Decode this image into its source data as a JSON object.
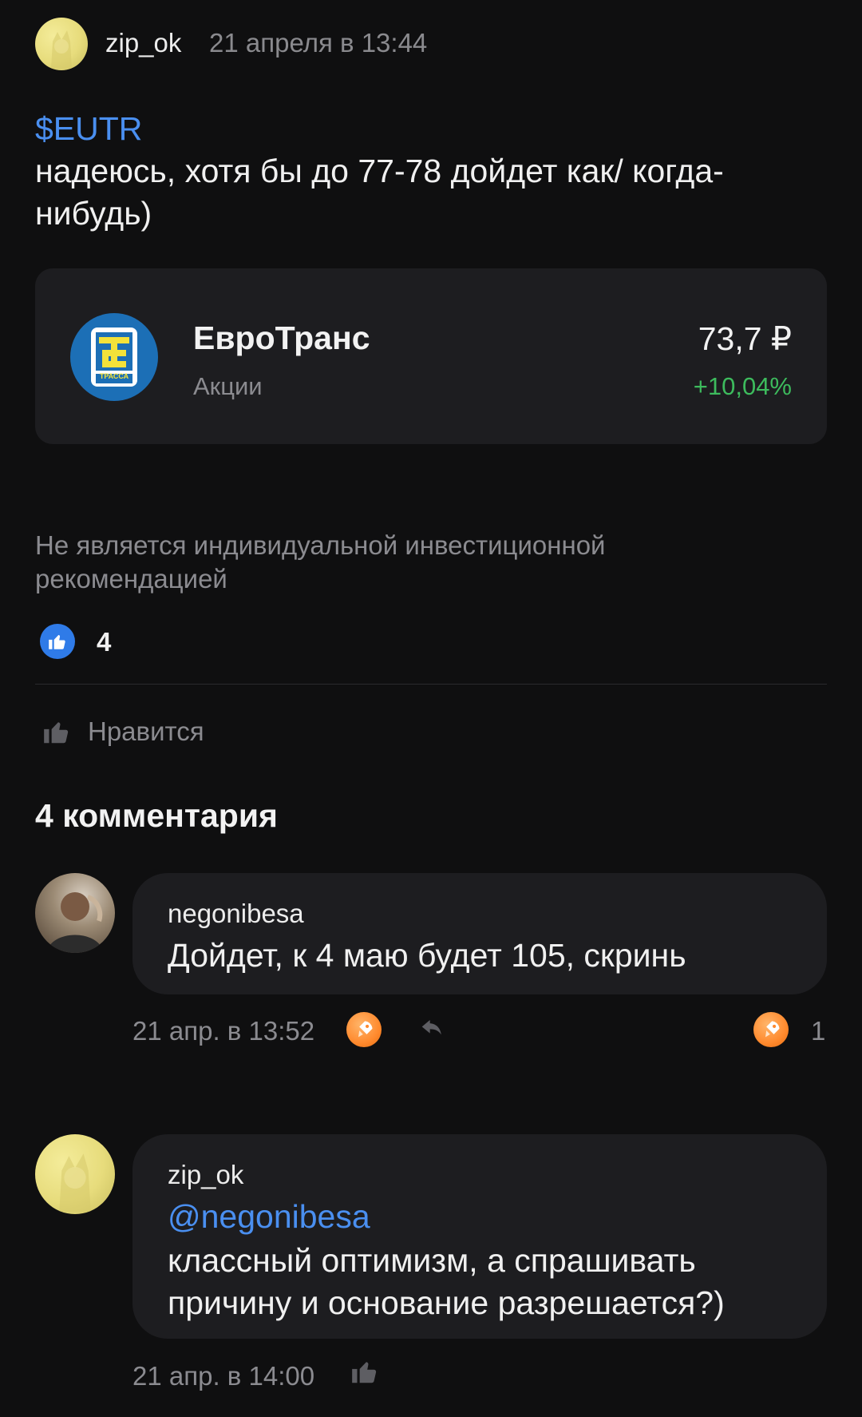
{
  "post": {
    "author": "zip_ok",
    "timestamp": "21 апреля в 13:44",
    "ticker": "$EUTR",
    "text": "надеюсь, хотя бы до 77-78 дойдет как/ когда-нибудь)"
  },
  "instrument": {
    "name": "ЕвроТранс",
    "type": "Акции",
    "price": "73,7 ₽",
    "change": "+10,04%",
    "logo_text": "ТРАССА"
  },
  "disclaimer": "Не является индивидуальной инвестиционной рекомендацией",
  "reactions": {
    "like_count": "4",
    "like_label": "Нравится"
  },
  "comments_title": "4 комментария",
  "comments": [
    {
      "author": "negonibesa",
      "text": "Дойдет, к 4 маю будет 105, скринь",
      "time": "21 апр. в 13:52",
      "rocket_count": "1"
    },
    {
      "author": "zip_ok",
      "mention": "@negonibesa",
      "text": "классный оптимизм, а спрашивать причину и основание разрешается?)",
      "time": "21 апр. в 14:00"
    }
  ],
  "colors": {
    "background": "#0f0f10",
    "card": "#1d1d20",
    "accent_link": "#4a8ff0",
    "positive": "#3dbb5d",
    "like_badge": "#2f7be8",
    "rocket": "#ff8a2e"
  },
  "icons": [
    "avatar-cat-icon",
    "eurotrans-logo-icon",
    "thumbs-up-icon",
    "rocket-icon",
    "reply-icon"
  ]
}
